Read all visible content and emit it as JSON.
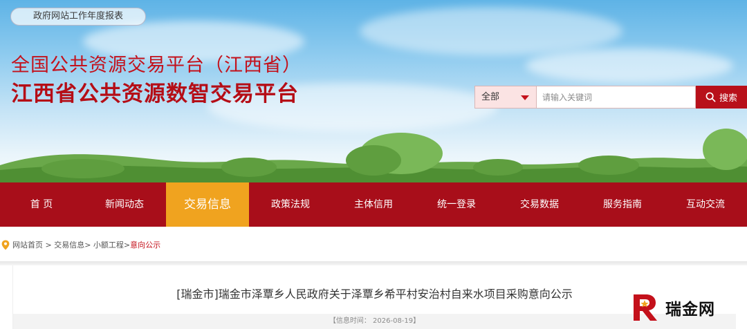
{
  "header": {
    "report_link": "政府网站工作年度报表",
    "title_line1": "全国公共资源交易平台（江西省）",
    "title_line2": "江西省公共资源数智交易平台"
  },
  "search": {
    "category": "全部",
    "placeholder": "请输入关键词",
    "button_label": "搜索"
  },
  "nav": {
    "items": [
      "首 页",
      "新闻动态",
      "交易信息",
      "政策法规",
      "主体信用",
      "统一登录",
      "交易数据",
      "服务指南",
      "互动交流"
    ],
    "active_index": 2
  },
  "breadcrumb": {
    "part1": "网站首页 > 交易信息> 小额工程>",
    "current": "意向公示"
  },
  "article": {
    "title": "[瑞金市]瑞金市泽覃乡人民政府关于泽覃乡希平村安治村自来水项目采购意向公示",
    "info": "【信息时间：  2026-08-19】"
  },
  "watermark": {
    "text": "瑞金网"
  },
  "colors": {
    "brand_red": "#a80e1a",
    "active_orange": "#f0a31f"
  }
}
